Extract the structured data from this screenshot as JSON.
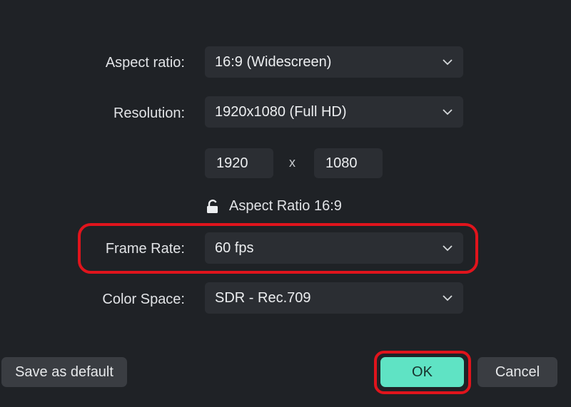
{
  "fields": {
    "aspect_ratio": {
      "label": "Aspect ratio:",
      "value": "16:9 (Widescreen)"
    },
    "resolution": {
      "label": "Resolution:",
      "value": "1920x1080 (Full HD)"
    },
    "width": "1920",
    "separator": "x",
    "height": "1080",
    "lock_text": "Aspect Ratio 16:9",
    "frame_rate": {
      "label": "Frame Rate:",
      "value": "60 fps"
    },
    "color_space": {
      "label": "Color Space:",
      "value": "SDR - Rec.709"
    }
  },
  "buttons": {
    "save_default": "Save as default",
    "ok": "OK",
    "cancel": "Cancel"
  },
  "colors": {
    "background": "#1f2226",
    "field": "#2b2e33",
    "accent": "#5fe3c4",
    "highlight": "#e0141c"
  },
  "icons": {
    "dropdown": "chevron-down-icon",
    "lock": "unlock-icon"
  }
}
